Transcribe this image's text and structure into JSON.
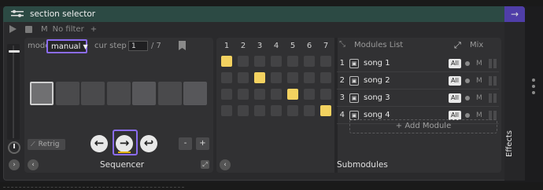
{
  "window": {
    "title": "section selector",
    "title_icon": "sliders-icon",
    "collapse_arrow": "→"
  },
  "transport": {
    "m_label": "M",
    "filter_label": "No filter",
    "add_label": "+"
  },
  "sequencer": {
    "mode_label": "mode",
    "mode_value": "manual",
    "curstep_label": "cur step",
    "curstep_value": "1",
    "total_steps": "/ 7",
    "retrig_label": "Retrig",
    "back_arrow": "←",
    "forward_arrow": "→",
    "return_arrow": "↩",
    "minus": "-",
    "plus": "+",
    "footer_label": "Sequencer",
    "left_chevron": "‹",
    "active_step": 1,
    "steps": 7
  },
  "submodules": {
    "columns": [
      "1",
      "2",
      "3",
      "4",
      "5",
      "6",
      "7"
    ],
    "grid": [
      [
        1,
        0,
        0,
        0,
        0,
        0,
        0
      ],
      [
        0,
        0,
        1,
        0,
        0,
        0,
        0
      ],
      [
        0,
        0,
        0,
        0,
        1,
        0,
        0
      ],
      [
        0,
        0,
        0,
        0,
        0,
        0,
        1
      ]
    ],
    "modules_list_label": "Modules List",
    "mix_label": "Mix",
    "rows": [
      {
        "num": "1",
        "name": "song 1",
        "all": "All",
        "m": "M"
      },
      {
        "num": "2",
        "name": "song 2",
        "all": "All",
        "m": "M"
      },
      {
        "num": "3",
        "name": "song 3",
        "all": "All",
        "m": "M"
      },
      {
        "num": "4",
        "name": "song 4",
        "all": "All",
        "m": "M"
      }
    ],
    "add_module_label": "+ Add Module",
    "footer_label": "Submodules",
    "left_chevron": "‹",
    "cell_on_color": "#f3d260"
  },
  "effects": {
    "label": "Effects"
  },
  "colors": {
    "accent": "#8b6cf0",
    "title_bg": "#2c4a44"
  }
}
